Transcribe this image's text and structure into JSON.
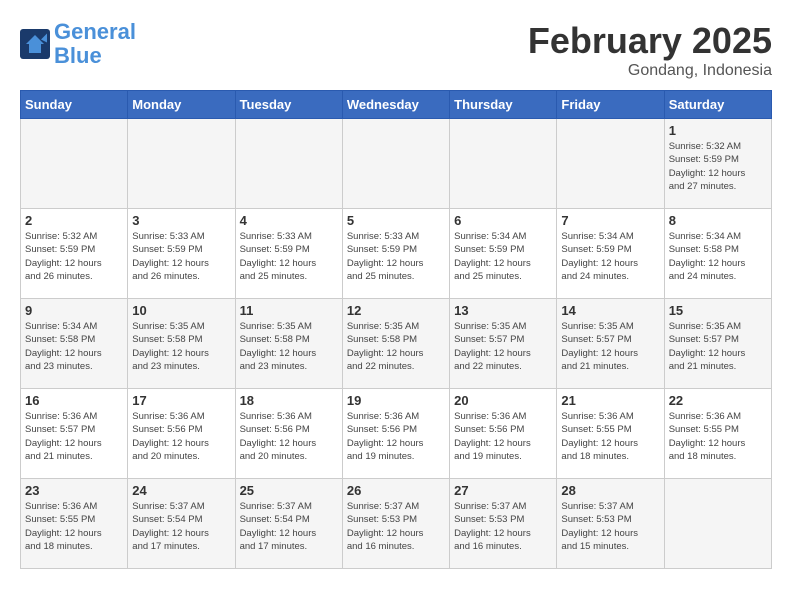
{
  "logo": {
    "line1": "General",
    "line2": "Blue"
  },
  "title": "February 2025",
  "location": "Gondang, Indonesia",
  "days_of_week": [
    "Sunday",
    "Monday",
    "Tuesday",
    "Wednesday",
    "Thursday",
    "Friday",
    "Saturday"
  ],
  "weeks": [
    [
      {
        "day": "",
        "info": ""
      },
      {
        "day": "",
        "info": ""
      },
      {
        "day": "",
        "info": ""
      },
      {
        "day": "",
        "info": ""
      },
      {
        "day": "",
        "info": ""
      },
      {
        "day": "",
        "info": ""
      },
      {
        "day": "1",
        "info": "Sunrise: 5:32 AM\nSunset: 5:59 PM\nDaylight: 12 hours\nand 27 minutes."
      }
    ],
    [
      {
        "day": "2",
        "info": "Sunrise: 5:32 AM\nSunset: 5:59 PM\nDaylight: 12 hours\nand 26 minutes."
      },
      {
        "day": "3",
        "info": "Sunrise: 5:33 AM\nSunset: 5:59 PM\nDaylight: 12 hours\nand 26 minutes."
      },
      {
        "day": "4",
        "info": "Sunrise: 5:33 AM\nSunset: 5:59 PM\nDaylight: 12 hours\nand 25 minutes."
      },
      {
        "day": "5",
        "info": "Sunrise: 5:33 AM\nSunset: 5:59 PM\nDaylight: 12 hours\nand 25 minutes."
      },
      {
        "day": "6",
        "info": "Sunrise: 5:34 AM\nSunset: 5:59 PM\nDaylight: 12 hours\nand 25 minutes."
      },
      {
        "day": "7",
        "info": "Sunrise: 5:34 AM\nSunset: 5:59 PM\nDaylight: 12 hours\nand 24 minutes."
      },
      {
        "day": "8",
        "info": "Sunrise: 5:34 AM\nSunset: 5:58 PM\nDaylight: 12 hours\nand 24 minutes."
      }
    ],
    [
      {
        "day": "9",
        "info": "Sunrise: 5:34 AM\nSunset: 5:58 PM\nDaylight: 12 hours\nand 23 minutes."
      },
      {
        "day": "10",
        "info": "Sunrise: 5:35 AM\nSunset: 5:58 PM\nDaylight: 12 hours\nand 23 minutes."
      },
      {
        "day": "11",
        "info": "Sunrise: 5:35 AM\nSunset: 5:58 PM\nDaylight: 12 hours\nand 23 minutes."
      },
      {
        "day": "12",
        "info": "Sunrise: 5:35 AM\nSunset: 5:58 PM\nDaylight: 12 hours\nand 22 minutes."
      },
      {
        "day": "13",
        "info": "Sunrise: 5:35 AM\nSunset: 5:57 PM\nDaylight: 12 hours\nand 22 minutes."
      },
      {
        "day": "14",
        "info": "Sunrise: 5:35 AM\nSunset: 5:57 PM\nDaylight: 12 hours\nand 21 minutes."
      },
      {
        "day": "15",
        "info": "Sunrise: 5:35 AM\nSunset: 5:57 PM\nDaylight: 12 hours\nand 21 minutes."
      }
    ],
    [
      {
        "day": "16",
        "info": "Sunrise: 5:36 AM\nSunset: 5:57 PM\nDaylight: 12 hours\nand 21 minutes."
      },
      {
        "day": "17",
        "info": "Sunrise: 5:36 AM\nSunset: 5:56 PM\nDaylight: 12 hours\nand 20 minutes."
      },
      {
        "day": "18",
        "info": "Sunrise: 5:36 AM\nSunset: 5:56 PM\nDaylight: 12 hours\nand 20 minutes."
      },
      {
        "day": "19",
        "info": "Sunrise: 5:36 AM\nSunset: 5:56 PM\nDaylight: 12 hours\nand 19 minutes."
      },
      {
        "day": "20",
        "info": "Sunrise: 5:36 AM\nSunset: 5:56 PM\nDaylight: 12 hours\nand 19 minutes."
      },
      {
        "day": "21",
        "info": "Sunrise: 5:36 AM\nSunset: 5:55 PM\nDaylight: 12 hours\nand 18 minutes."
      },
      {
        "day": "22",
        "info": "Sunrise: 5:36 AM\nSunset: 5:55 PM\nDaylight: 12 hours\nand 18 minutes."
      }
    ],
    [
      {
        "day": "23",
        "info": "Sunrise: 5:36 AM\nSunset: 5:55 PM\nDaylight: 12 hours\nand 18 minutes."
      },
      {
        "day": "24",
        "info": "Sunrise: 5:37 AM\nSunset: 5:54 PM\nDaylight: 12 hours\nand 17 minutes."
      },
      {
        "day": "25",
        "info": "Sunrise: 5:37 AM\nSunset: 5:54 PM\nDaylight: 12 hours\nand 17 minutes."
      },
      {
        "day": "26",
        "info": "Sunrise: 5:37 AM\nSunset: 5:53 PM\nDaylight: 12 hours\nand 16 minutes."
      },
      {
        "day": "27",
        "info": "Sunrise: 5:37 AM\nSunset: 5:53 PM\nDaylight: 12 hours\nand 16 minutes."
      },
      {
        "day": "28",
        "info": "Sunrise: 5:37 AM\nSunset: 5:53 PM\nDaylight: 12 hours\nand 15 minutes."
      },
      {
        "day": "",
        "info": ""
      }
    ]
  ]
}
